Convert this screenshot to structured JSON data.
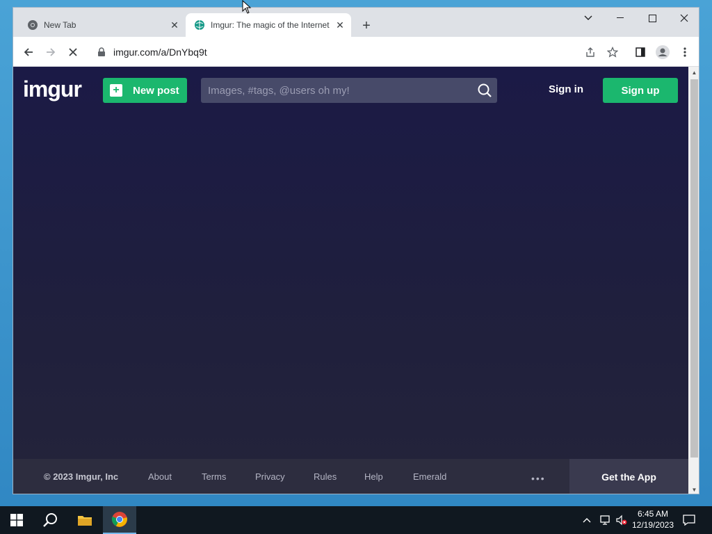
{
  "browser": {
    "tabs": [
      {
        "title": "New Tab",
        "active": false
      },
      {
        "title": "Imgur: The magic of the Internet",
        "active": true
      }
    ],
    "address": "imgur.com/a/DnYbq9t"
  },
  "imgur": {
    "logo": "imgur",
    "new_post_label": "New post",
    "search_placeholder": "Images, #tags, @users oh my!",
    "sign_in_label": "Sign in",
    "sign_up_label": "Sign up",
    "brand_green": "#1bb76e"
  },
  "footer": {
    "copyright": "© 2023 Imgur, Inc",
    "links": [
      "About",
      "Terms",
      "Privacy",
      "Rules",
      "Help",
      "Emerald"
    ],
    "more": "•••",
    "get_app": "Get the App"
  },
  "taskbar": {
    "time": "6:45 AM",
    "date": "12/19/2023"
  }
}
